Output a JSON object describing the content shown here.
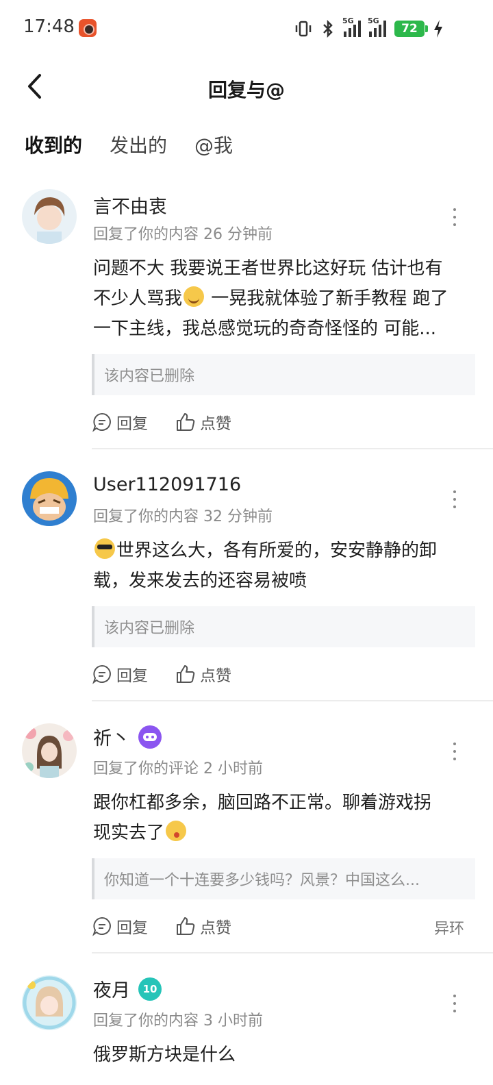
{
  "status_bar": {
    "time": "17:48",
    "battery": "72",
    "network": [
      "5G",
      "5G"
    ]
  },
  "header": {
    "title": "回复与@"
  },
  "tabs": [
    {
      "label": "收到的",
      "active": true
    },
    {
      "label": "发出的",
      "active": false
    },
    {
      "label": "@我",
      "active": false
    }
  ],
  "icons": {
    "back": "back-arrow-icon",
    "more": "more-vertical-icon",
    "reply": "reply-bubble-icon",
    "like": "thumbs-up-icon",
    "badge_game": "gamepad-badge-icon",
    "badge_level": "level-badge-icon"
  },
  "colors": {
    "accent": "#30d8c8",
    "battery": "#2db84b",
    "badge_purple": "#8b55f0",
    "badge_teal": "#26c4b8"
  },
  "items": [
    {
      "username": "言不由衷",
      "meta": "回复了你的内容 26 分钟前",
      "content_lines": [
        "问题不大 我要说王者世界比这好玩 估计也有",
        "不少人骂我",
        " 一晃我就体验了新手教程 跑了",
        "一下主线，我总感觉玩的奇奇怪怪的 可能..."
      ],
      "quote": "该内容已删除",
      "reply_label": "回复",
      "like_label": "点赞",
      "game_tag": ""
    },
    {
      "username": "User112091716",
      "meta": "回复了你的内容 32 分钟前",
      "content_lines": [
        "世界这么大，各有所爱的，安安静静的卸",
        "载，发来发去的还容易被喷"
      ],
      "quote": "该内容已删除",
      "reply_label": "回复",
      "like_label": "点赞",
      "game_tag": ""
    },
    {
      "username": "祈丶",
      "meta": "回复了你的评论 2 小时前",
      "content_lines": [
        "跟你杠都多余，脑回路不正常。聊着游戏拐",
        "现实去了"
      ],
      "quote": "你知道一个十连要多少钱吗？风景？中国这么...",
      "reply_label": "回复",
      "like_label": "点赞",
      "game_tag": "异环"
    },
    {
      "username": "夜月",
      "badge_text": "10",
      "meta": "回复了你的内容 3 小时前",
      "content_lines": [
        "俄罗斯方块是什么"
      ]
    }
  ]
}
